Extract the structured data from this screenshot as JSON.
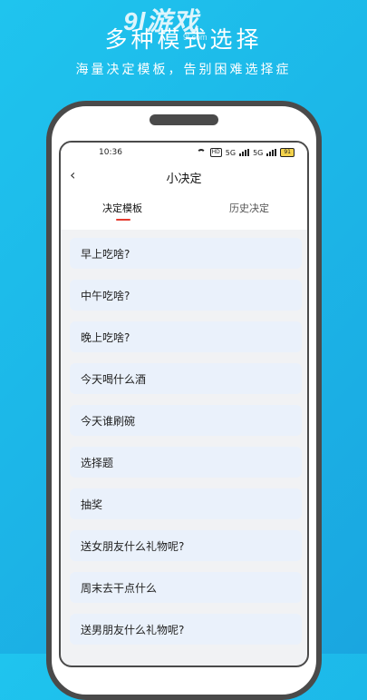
{
  "promo": {
    "headline": "多种模式选择",
    "subline": "海量决定模板，告别困难选择症",
    "watermark_main": "9l游戏",
    "watermark_sub": "9l.com"
  },
  "status_bar": {
    "time": "10:36",
    "hd": "HD",
    "sig1": "5G",
    "sig2": "5G",
    "battery": "91"
  },
  "nav": {
    "back_icon": "chevron-left-icon",
    "back_glyph": "‹",
    "title": "小决定"
  },
  "tabs": [
    {
      "label": "决定模板",
      "active": true
    },
    {
      "label": "历史决定",
      "active": false
    }
  ],
  "accent_color": "#e53b2f",
  "templates": [
    {
      "label": "早上吃啥?"
    },
    {
      "label": "中午吃啥?"
    },
    {
      "label": "晚上吃啥?"
    },
    {
      "label": "今天喝什么酒"
    },
    {
      "label": "今天谁刷碗"
    },
    {
      "label": "选择题"
    },
    {
      "label": "抽奖"
    },
    {
      "label": "送女朋友什么礼物呢?"
    },
    {
      "label": "周末去干点什么"
    },
    {
      "label": "送男朋友什么礼物呢?"
    }
  ]
}
